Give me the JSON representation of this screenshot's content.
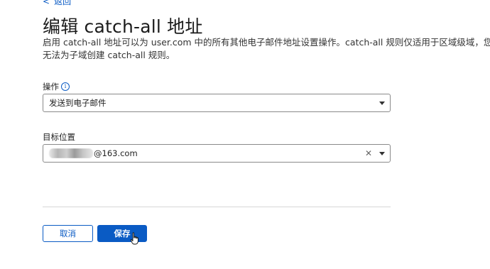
{
  "nav": {
    "back_label": "返回"
  },
  "page": {
    "title": "编辑 catch-all 地址",
    "description": "启用 catch-all 地址可以为 user.com 中的所有其他电子邮件地址设置操作。catch-all 规则仅适用于区域级域，您无法为子域创建 catch-all 规则。"
  },
  "action_field": {
    "label": "操作",
    "selected": "发送到电子邮件"
  },
  "destination_field": {
    "label": "目标位置",
    "value_suffix": "@163.com"
  },
  "buttons": {
    "cancel_label": "取消",
    "save_label": "保存"
  },
  "colors": {
    "accent": "#0a5bc4",
    "text": "#1b1b1b",
    "border": "#8a8a8a",
    "divider": "#d6d6d6"
  },
  "icons": [
    "chevron-left-icon",
    "info-icon",
    "chevron-down-icon",
    "close-icon",
    "hand-pointer-icon"
  ]
}
